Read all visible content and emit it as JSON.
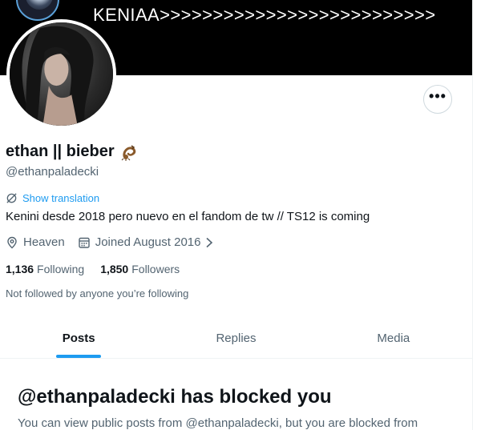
{
  "banner": {
    "text": "KENIAA>>>>>>>>>>>>>>>>>>>>>>>>>>"
  },
  "profile": {
    "display_name": "ethan || bieber",
    "handle": "@ethanpaladecki",
    "more_button_label": "•••",
    "show_translation": "Show translation",
    "bio": "Kenini desde 2018 pero nuevo en el fandom de tw // TS12 is coming",
    "location": "Heaven",
    "joined": "Joined August 2016",
    "following_count": "1,136",
    "following_label": "Following",
    "followers_count": "1,850",
    "followers_label": "Followers",
    "not_followed": "Not followed by anyone you’re following"
  },
  "tabs": [
    {
      "label": "Posts",
      "active": true
    },
    {
      "label": "Replies",
      "active": false
    },
    {
      "label": "Media",
      "active": false
    }
  ],
  "blocked": {
    "title": "@ethanpaladecki has blocked you",
    "subtitle": "You can view public posts from @ethanpaladecki, but you are blocked from"
  },
  "colors": {
    "accent": "#1d9bf0",
    "text_primary": "#0f1419",
    "text_secondary": "#536471",
    "border": "#eff3f4"
  }
}
